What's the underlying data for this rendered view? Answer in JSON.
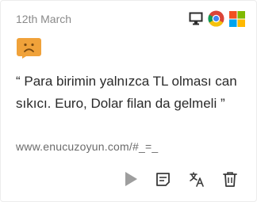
{
  "card": {
    "date": "12th March",
    "platform_icons": [
      "desktop-icon",
      "chrome-icon",
      "windows-icon"
    ],
    "sentiment_icon": "sad-face-icon",
    "sentiment_color": "#f0a23a",
    "quote": "“ Para birimin yalnızca TL olması can sıkıcı. Euro, Dolar filan da gelmeli ”",
    "url": "www.enucuzoyun.com/#_=_",
    "actions": [
      "play-icon",
      "note-icon",
      "translate-icon",
      "trash-icon"
    ]
  }
}
